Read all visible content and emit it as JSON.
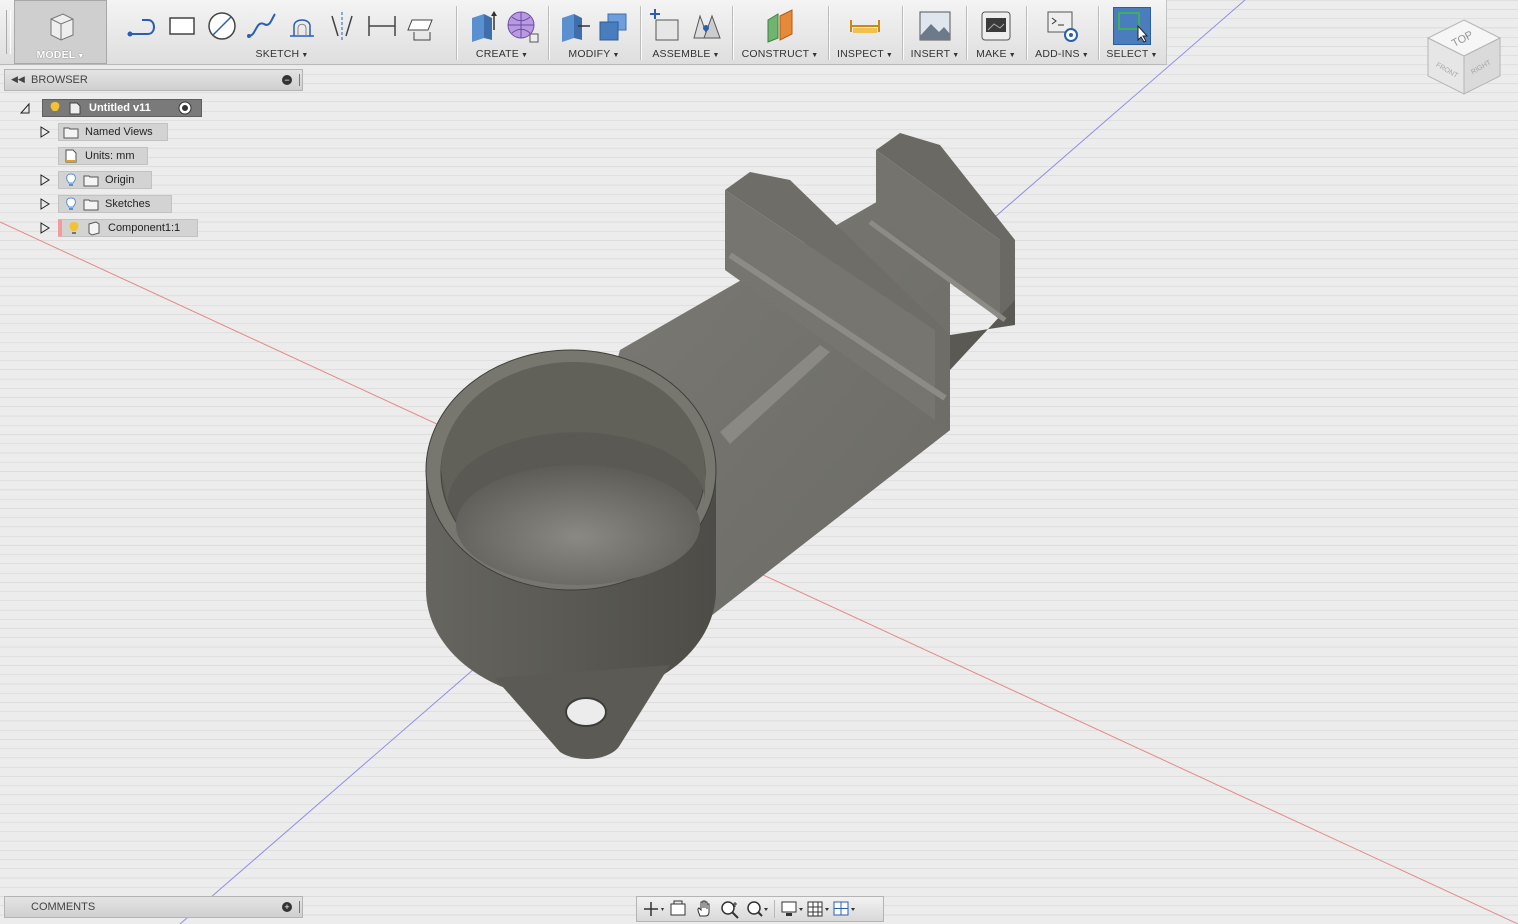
{
  "toolbar": {
    "workspace": "MODEL",
    "groups": {
      "sketch": "SKETCH",
      "create": "CREATE",
      "modify": "MODIFY",
      "assemble": "ASSEMBLE",
      "construct": "CONSTRUCT",
      "inspect": "INSPECT",
      "insert": "INSERT",
      "make": "MAKE",
      "addins": "ADD-INS",
      "select": "SELECT"
    }
  },
  "browser": {
    "title": "BROWSER",
    "items": [
      {
        "label": "Untitled v11"
      },
      {
        "label": "Named Views"
      },
      {
        "label": "Units: mm"
      },
      {
        "label": "Origin"
      },
      {
        "label": "Sketches"
      },
      {
        "label": "Component1:1"
      }
    ]
  },
  "comments": {
    "title": "COMMENTS"
  },
  "viewcube": {
    "top": "TOP",
    "front": "FRONT",
    "right": "RIGHT"
  },
  "colors": {
    "accent": "#4a7dbd",
    "model": "#5e5c56",
    "bulb": "#f2c230"
  }
}
